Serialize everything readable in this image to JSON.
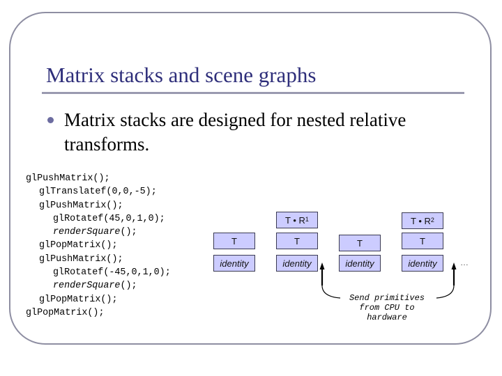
{
  "slide": {
    "title": "Matrix stacks and scene graphs",
    "bullets": [
      {
        "text": "Matrix stacks are designed for nested relative transforms."
      }
    ],
    "code": {
      "lines": [
        {
          "indent": 0,
          "text": "glPushMatrix();"
        },
        {
          "indent": 1,
          "text": "glTranslatef(0,0,-5);"
        },
        {
          "indent": 1,
          "text": "glPushMatrix();"
        },
        {
          "indent": 2,
          "text": "glRotatef(45,0,1,0);"
        },
        {
          "indent": 2,
          "text": "renderSquare",
          "suffix": "();",
          "italic": true
        },
        {
          "indent": 1,
          "text": "glPopMatrix();"
        },
        {
          "indent": 1,
          "text": "glPushMatrix();"
        },
        {
          "indent": 2,
          "text": "glRotatef(-45,0,1,0);"
        },
        {
          "indent": 2,
          "text": "renderSquare",
          "suffix": "();",
          "italic": true
        },
        {
          "indent": 1,
          "text": "glPopMatrix();"
        },
        {
          "indent": 0,
          "text": "glPopMatrix();"
        }
      ]
    },
    "diagram": {
      "stacks": [
        {
          "entries": [
            "identity",
            "T"
          ]
        },
        {
          "entries": [
            "identity",
            "T",
            "T • R",
            "1"
          ]
        },
        {
          "entries": [
            "identity",
            "T"
          ]
        },
        {
          "entries": [
            "identity",
            "T",
            "T • R",
            "2"
          ]
        }
      ],
      "labels": {
        "identity": "identity",
        "T": "T",
        "tr_base": "T • R",
        "tr1_sup": "1",
        "tr2_sup": "2"
      },
      "ellipsis": "…",
      "annotation": [
        "Send primitives",
        "from CPU to",
        "hardware"
      ]
    },
    "colors": {
      "title": "#2e2e7a",
      "frame": "#8e8ea2",
      "box_fill": "#ccccff",
      "box_border": "#3a3a52",
      "bullet": "#6c6ca0"
    }
  }
}
